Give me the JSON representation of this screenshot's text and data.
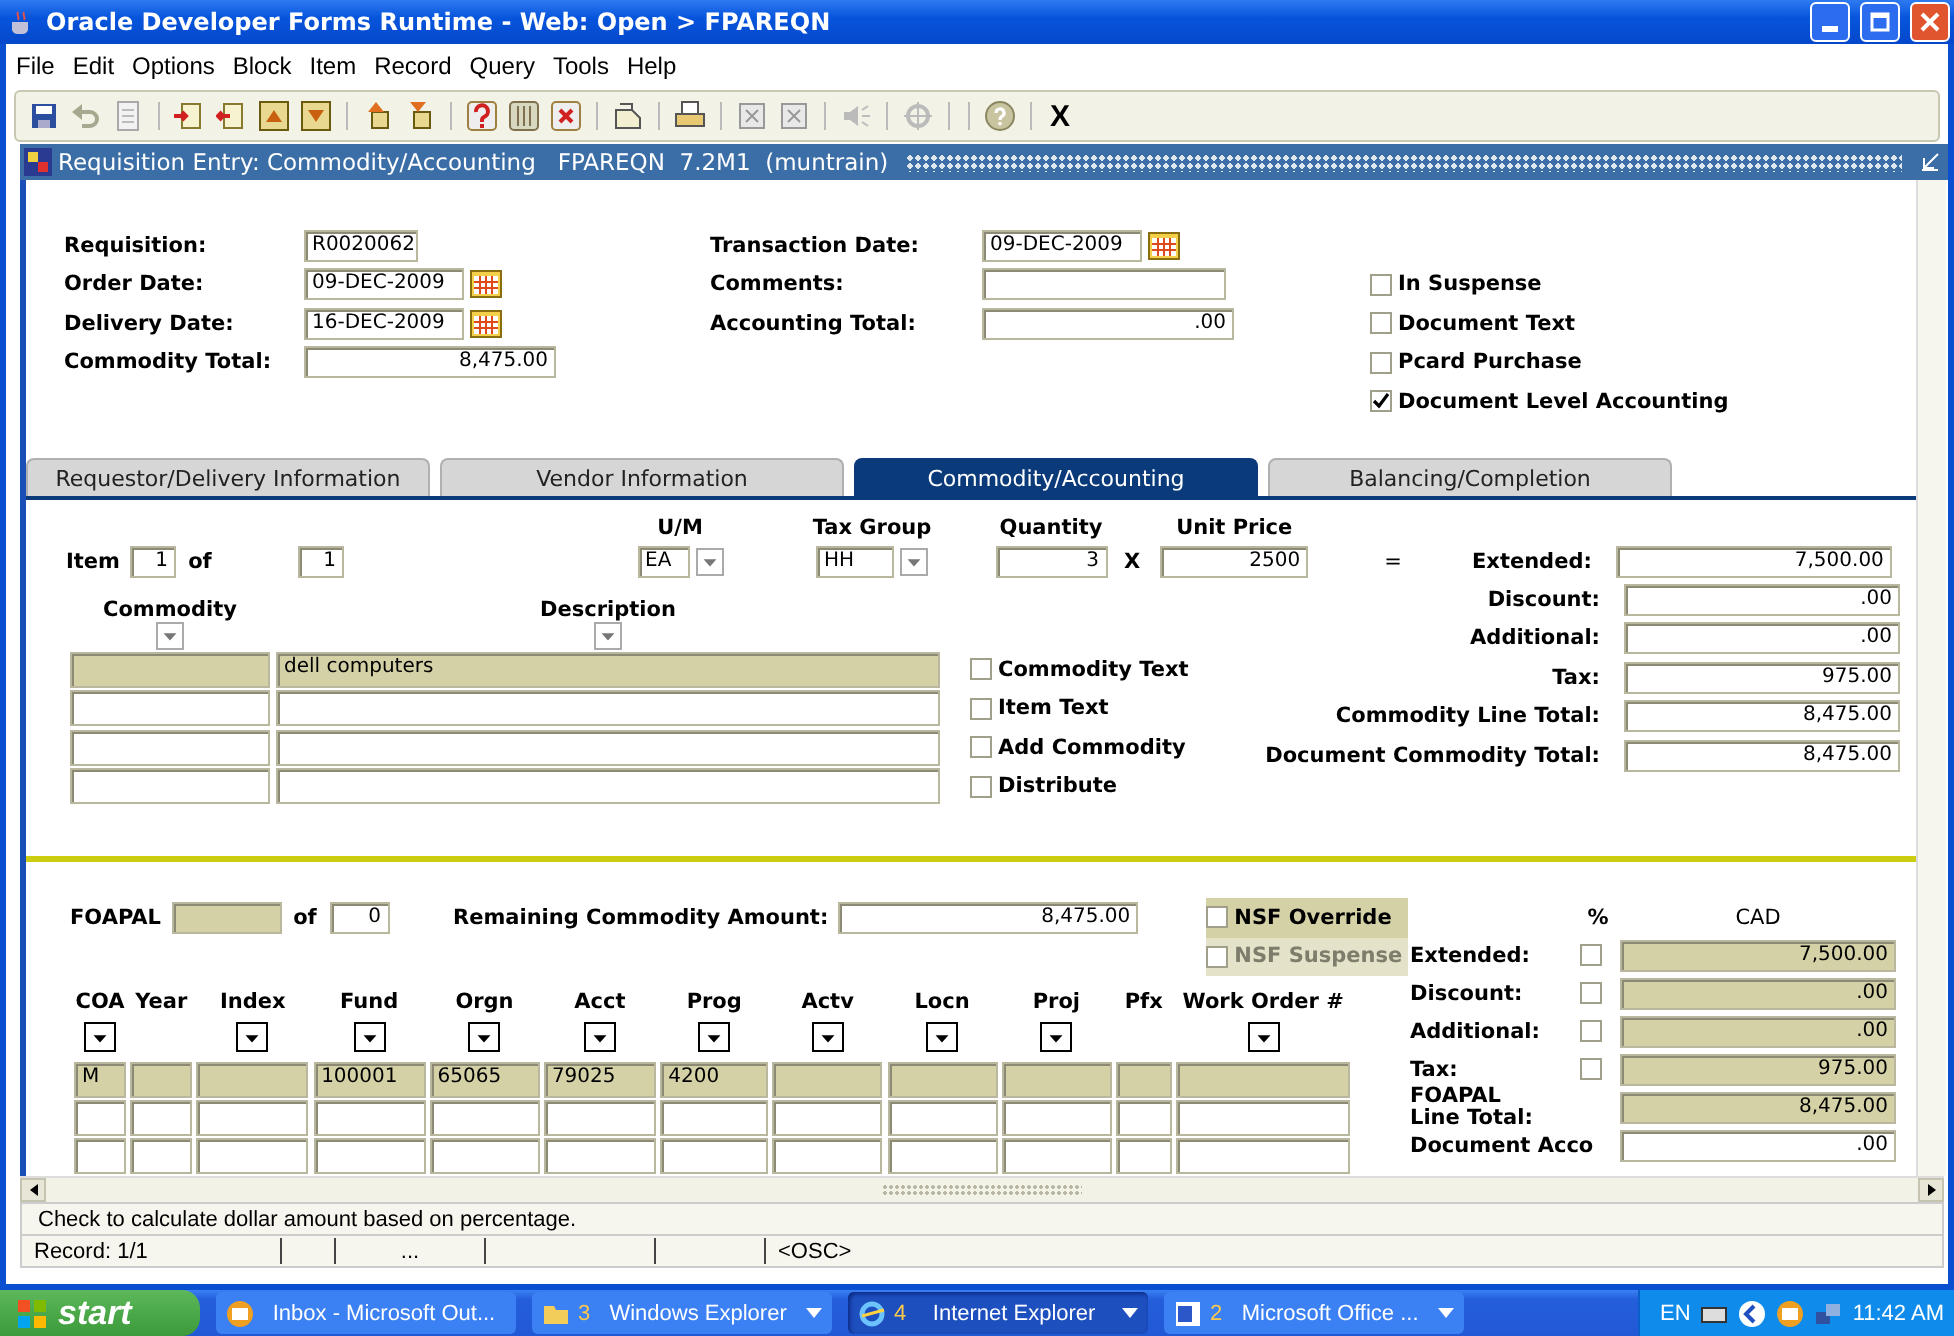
{
  "window": {
    "title": "Oracle Developer Forms Runtime - Web:  Open > FPAREQN"
  },
  "menu": [
    "File",
    "Edit",
    "Options",
    "Block",
    "Item",
    "Record",
    "Query",
    "Tools",
    "Help"
  ],
  "toolbar": {
    "exit": "X"
  },
  "form_title": "Requisition Entry: Commodity/Accounting   FPAREQN  7.2M1  (muntrain)",
  "header": {
    "left_fields": [
      {
        "label": "Requisition:",
        "value": "R0020062",
        "kind": "code"
      },
      {
        "label": "Order Date:",
        "value": "09-DEC-2009",
        "kind": "date"
      },
      {
        "label": "Delivery Date:",
        "value": "16-DEC-2009",
        "kind": "date"
      },
      {
        "label": "Commodity Total:",
        "value": "8,475.00",
        "kind": "amount"
      }
    ],
    "middle_fields": [
      {
        "label": "Transaction Date:",
        "value": "09-DEC-2009",
        "kind": "date"
      },
      {
        "label": "Comments:",
        "kind": "text"
      },
      {
        "label": "Accounting Total:",
        "value": ".00",
        "kind": "amount"
      }
    ],
    "checkboxes": [
      {
        "label": "In Suspense",
        "checked": false
      },
      {
        "label": "Document Text",
        "checked": false
      },
      {
        "label": "Pcard Purchase",
        "checked": false
      },
      {
        "label": "Document Level Accounting",
        "checked": true
      }
    ]
  },
  "tabs": [
    {
      "label": "Requestor/Delivery Information",
      "selected": false
    },
    {
      "label": "Vendor Information",
      "selected": false
    },
    {
      "label": "Commodity/Accounting",
      "selected": true
    },
    {
      "label": "Balancing/Completion",
      "selected": false
    }
  ],
  "commodity": {
    "item_label": "Item",
    "item": "1",
    "of_label": "of",
    "item_count": "1",
    "um": {
      "label": "U/M",
      "value": "EA"
    },
    "tax_group": {
      "label": "Tax Group",
      "value": "HH"
    },
    "quantity": {
      "label": "Quantity",
      "value": "3"
    },
    "times": "X",
    "unit_price": {
      "label": "Unit Price",
      "value": "2500"
    },
    "equals": "=",
    "columns": [
      "Commodity",
      "Description"
    ],
    "rows": [
      {
        "description": "dell computers",
        "current": true
      },
      {
        "current": false
      },
      {
        "current": false
      },
      {
        "current": false
      }
    ],
    "checkboxes": [
      {
        "label": "Commodity Text",
        "checked": false
      },
      {
        "label": "Item Text",
        "checked": false
      },
      {
        "label": "Add Commodity",
        "checked": false
      },
      {
        "label": "Distribute",
        "checked": false
      }
    ],
    "totals": [
      {
        "label": "Extended:",
        "value": "7,500.00"
      },
      {
        "label": "Discount:",
        "value": ".00"
      },
      {
        "label": "Additional:",
        "value": ".00"
      },
      {
        "label": "Tax:",
        "value": "975.00"
      },
      {
        "label": "Commodity Line Total:",
        "value": "8,475.00"
      },
      {
        "label": "Document Commodity Total:",
        "value": "8,475.00"
      }
    ]
  },
  "foapal": {
    "label": "FOAPAL",
    "of_label": "of",
    "count": "0",
    "remaining_label": "Remaining Commodity Amount:",
    "remaining": "8,475.00",
    "nsf": [
      {
        "label": "NSF Override",
        "checked": false,
        "disabled": false
      },
      {
        "label": "NSF Suspense",
        "checked": false,
        "disabled": true
      }
    ],
    "columns": [
      {
        "label": "COA",
        "dropdown": true
      },
      {
        "label": "Year",
        "dropdown": false
      },
      {
        "label": "Index",
        "dropdown": true
      },
      {
        "label": "Fund",
        "dropdown": true
      },
      {
        "label": "Orgn",
        "dropdown": true
      },
      {
        "label": "Acct",
        "dropdown": true
      },
      {
        "label": "Prog",
        "dropdown": true
      },
      {
        "label": "Actv",
        "dropdown": true
      },
      {
        "label": "Locn",
        "dropdown": true
      },
      {
        "label": "Proj",
        "dropdown": true
      },
      {
        "label": "Pfx",
        "dropdown": false
      },
      {
        "label": "Work Order #",
        "dropdown": true
      }
    ],
    "rows": [
      {
        "current": true,
        "cells": [
          "M",
          null,
          null,
          "100001",
          "65065",
          "79025",
          "4200",
          null,
          null,
          null,
          null,
          null
        ]
      },
      {
        "current": false
      },
      {
        "current": false
      }
    ],
    "percent_label": "%",
    "currency": "CAD",
    "amounts": [
      {
        "label": "Extended:",
        "value": "7,500.00",
        "kind": "percent",
        "checked": false
      },
      {
        "label": "Discount:",
        "value": ".00",
        "kind": "percent",
        "checked": false
      },
      {
        "label": "Additional:",
        "value": ".00",
        "kind": "percent",
        "checked": false
      },
      {
        "label": "Tax:",
        "value": "975.00",
        "kind": "percent",
        "checked": false
      },
      {
        "label": "FOAPAL\nLine Total:",
        "value": "8,475.00",
        "kind": "total"
      },
      {
        "label": "Document  Acco",
        "value": ".00",
        "kind": "entry"
      }
    ]
  },
  "hint": "Check  to calculate dollar amount based on percentage.",
  "status": {
    "record": "Record: 1/1",
    "indicator": "...",
    "mode": "<OSC>"
  },
  "taskbar": {
    "start": "start",
    "tasks": [
      {
        "label": "Inbox - Microsoft Out...",
        "kind": "mail",
        "selected": false,
        "group": false
      },
      {
        "count": "3",
        "label": "Windows Explorer",
        "kind": "folder",
        "selected": false,
        "group": true
      },
      {
        "count": "4",
        "label": "Internet Explorer",
        "kind": "browser",
        "selected": true,
        "group": true
      },
      {
        "count": "2",
        "label": "Microsoft Office ...",
        "kind": "word",
        "selected": false,
        "group": true
      }
    ],
    "language": "EN",
    "clock": "11:42 AM"
  }
}
